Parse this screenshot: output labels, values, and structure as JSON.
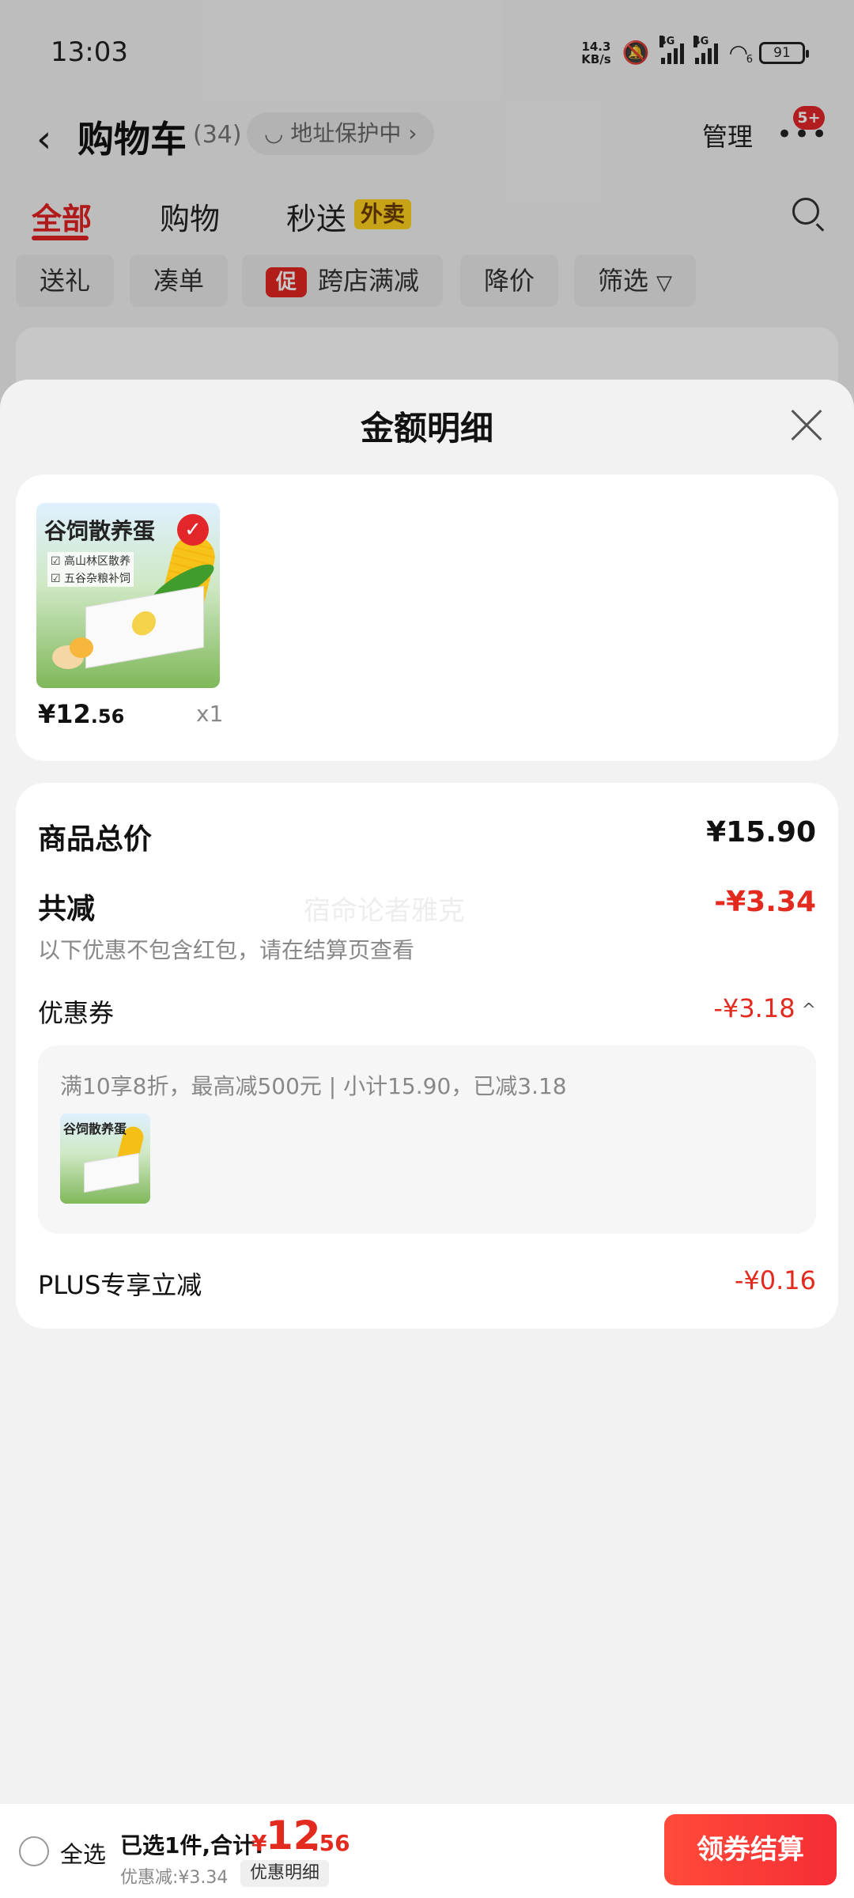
{
  "status_bar": {
    "time": "13:03",
    "net_speed_value": "14.3",
    "net_speed_unit": "KB/s",
    "signal1_label": "4G",
    "signal2_label": "4G",
    "wifi_label": "6",
    "battery": "91"
  },
  "header": {
    "title": "购物车",
    "count": "(34)",
    "address_chip": "地址保护中",
    "manage_label": "管理",
    "more_badge": "5+"
  },
  "tabs": [
    {
      "label": "全部"
    },
    {
      "label": "购物"
    },
    {
      "label": "秒送"
    }
  ],
  "tab_tag": "外卖",
  "filters": [
    {
      "label": "送礼"
    },
    {
      "label": "凑单"
    },
    {
      "label": "跨店满减"
    },
    {
      "label": "降价"
    },
    {
      "label": "筛选"
    }
  ],
  "promo_badge": "促",
  "sheet": {
    "title": "金额明细",
    "product": {
      "image_title": "谷饲散养蛋",
      "image_line1": "高山林区散养",
      "image_line2": "五谷杂粮补饲",
      "price_symbol": "¥",
      "price_int": "12",
      "price_dec": ".56",
      "qty": "x1"
    },
    "details": {
      "total_label": "商品总价",
      "total_value": "¥15.90",
      "reduce_label": "共减",
      "reduce_value": "-¥3.34",
      "reduce_note": "以下优惠不包含红包，请在结算页查看",
      "coupon_label": "优惠券",
      "coupon_value": "-¥3.18",
      "coupon_desc": "满10享8折，最高减500元 | 小计15.90，已减3.18",
      "plus_label": "PLUS专享立减",
      "plus_value": "-¥0.16"
    },
    "watermark": "宿命论者雅克"
  },
  "bottom": {
    "select_all": "全选",
    "summary": "已选1件,合计:",
    "total_symbol": "¥",
    "total_int": "12",
    "total_dec": ".56",
    "discount": "优惠减:¥3.34",
    "detail_chip": "优惠明细",
    "checkout": "领券结算"
  },
  "colors": {
    "accent_red": "#e32a1f",
    "checkout_gradient_start": "#ff4b3a",
    "tab_tag_yellow": "#ffd21e"
  }
}
